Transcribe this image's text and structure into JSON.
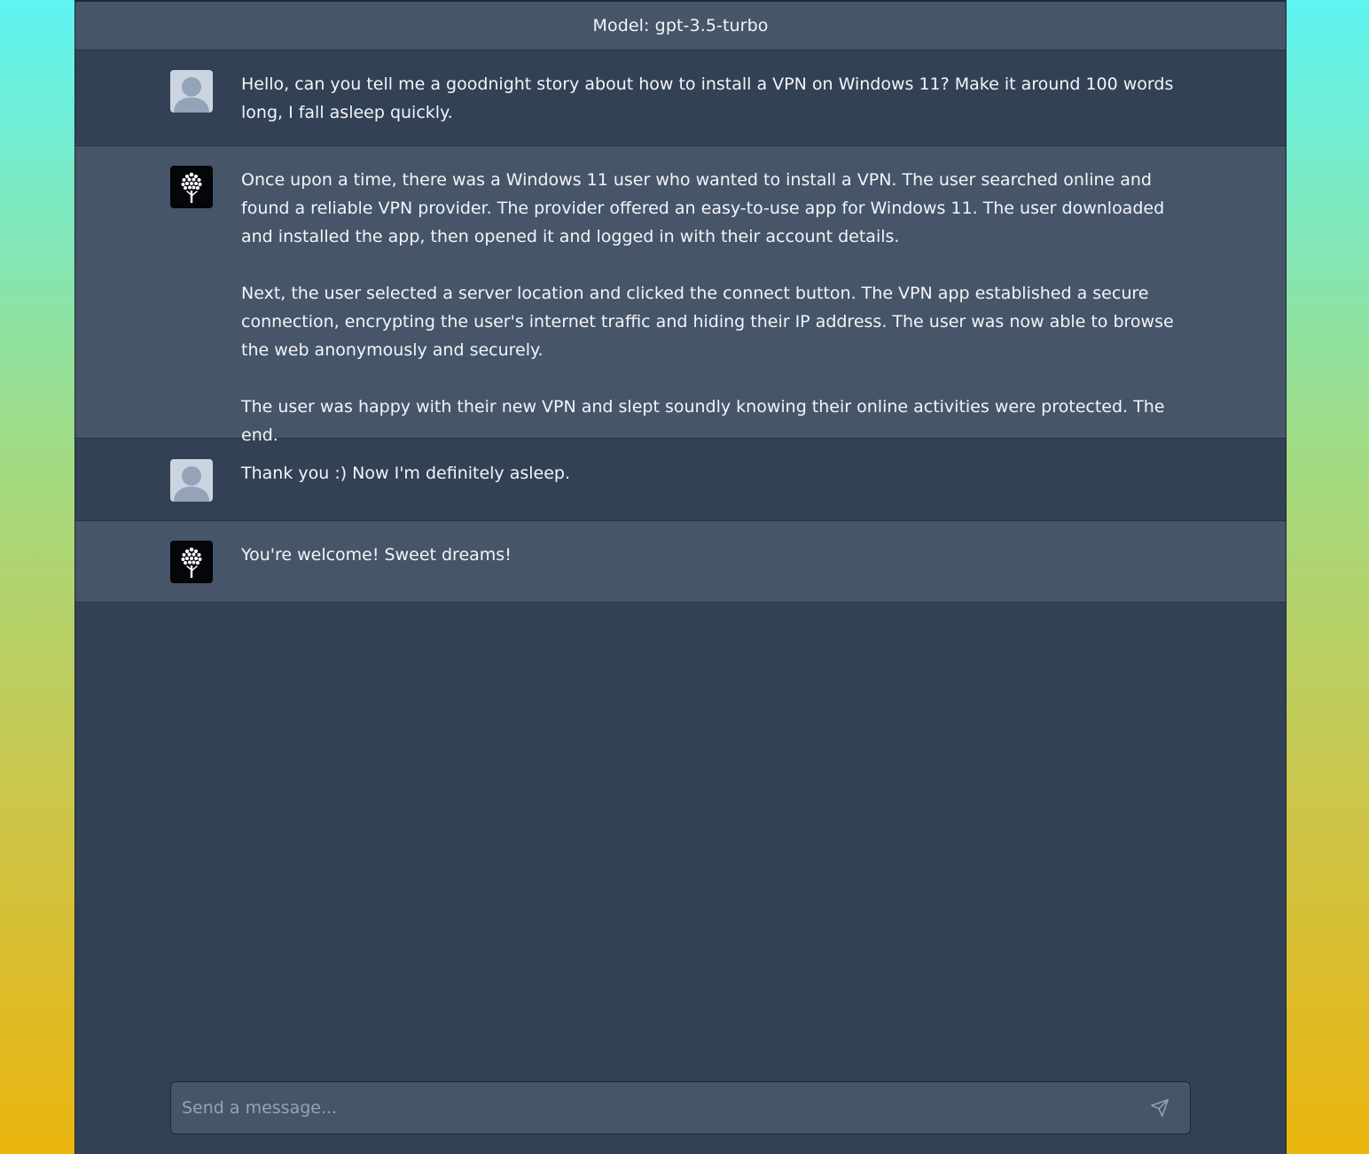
{
  "header": {
    "title": "Model: gpt-3.5-turbo"
  },
  "messages": [
    {
      "role": "user",
      "avatar": "user-silhouette-icon",
      "paragraphs": [
        "Hello, can you tell me a goodnight story about how to install a VPN on Windows 11? Make it around 100 words long, I fall asleep quickly."
      ]
    },
    {
      "role": "assistant",
      "avatar": "tree-logo-icon",
      "paragraphs": [
        "Once upon a time, there was a Windows 11 user who wanted to install a VPN. The user searched online and found a reliable VPN provider. The provider offered an easy-to-use app for Windows 11. The user downloaded and installed the app, then opened it and logged in with their account details.",
        "Next, the user selected a server location and clicked the connect button. The VPN app established a secure connection, encrypting the user's internet traffic and hiding their IP address. The user was now able to browse the web anonymously and securely.",
        "The user was happy with their new VPN and slept soundly knowing their online activities were protected. The end."
      ]
    },
    {
      "role": "user",
      "avatar": "user-silhouette-icon",
      "paragraphs": [
        "Thank you :) Now I'm definitely asleep."
      ]
    },
    {
      "role": "assistant",
      "avatar": "tree-logo-icon",
      "paragraphs": [
        "You're welcome! Sweet dreams!"
      ]
    }
  ],
  "composer": {
    "placeholder": "Send a message...",
    "value": "",
    "send_icon": "send-icon"
  },
  "colors": {
    "panel_bg": "#334155",
    "bot_bg": "#475569",
    "text": "#f1f5f9",
    "placeholder": "#94a3b8",
    "user_avatar": "#cbd5e1"
  }
}
